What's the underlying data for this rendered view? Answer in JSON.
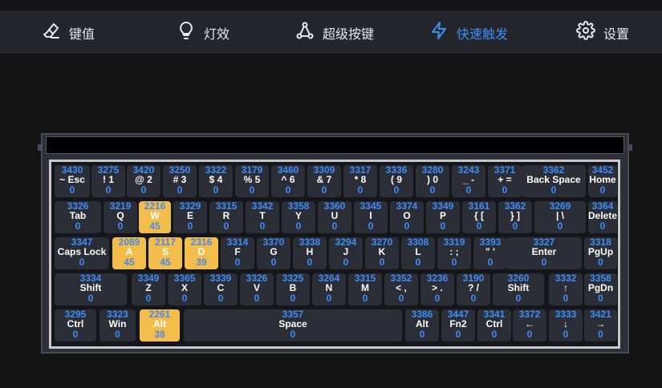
{
  "nav": [
    {
      "label": "键值",
      "icon": "eraser-icon",
      "active": false
    },
    {
      "label": "灯效",
      "icon": "lightbulb-icon",
      "active": false
    },
    {
      "label": "超级按键",
      "icon": "share-nodes-icon",
      "active": false
    },
    {
      "label": "快速触发",
      "icon": "lightning-icon",
      "active": true
    },
    {
      "label": "设置",
      "icon": "gear-icon",
      "active": false
    }
  ],
  "colors": {
    "accent": "#3f8ef7",
    "highlight": "#f2bd4a",
    "key_bg": "#2b2d37"
  },
  "rows": [
    [
      {
        "label": "~ Esc",
        "num": "3430",
        "val": "0"
      },
      {
        "label": "! 1",
        "num": "3275",
        "val": "0"
      },
      {
        "label": "@ 2",
        "num": "3420",
        "val": "0"
      },
      {
        "label": "# 3",
        "num": "3250",
        "val": "0"
      },
      {
        "label": "$ 4",
        "num": "3322",
        "val": "0"
      },
      {
        "label": "% 5",
        "num": "3179",
        "val": "0"
      },
      {
        "label": "^ 6",
        "num": "3460",
        "val": "0"
      },
      {
        "label": "& 7",
        "num": "3309",
        "val": "0"
      },
      {
        "label": "* 8",
        "num": "3317",
        "val": "0"
      },
      {
        "label": "( 9",
        "num": "3336",
        "val": "0"
      },
      {
        "label": ") 0",
        "num": "3280",
        "val": "0"
      },
      {
        "label": "_ -",
        "num": "3243",
        "val": "0"
      },
      {
        "label": "+ =",
        "num": "3371",
        "val": "0"
      },
      {
        "label": "Back Space",
        "num": "3362",
        "val": "0"
      },
      {
        "label": "Home",
        "num": "3452",
        "val": "0"
      }
    ],
    [
      {
        "label": "Tab",
        "num": "3326",
        "val": "0"
      },
      {
        "label": "Q",
        "num": "3219",
        "val": "0"
      },
      {
        "label": "W",
        "num": "2216",
        "val": "45",
        "hl": true
      },
      {
        "label": "E",
        "num": "3329",
        "val": "0"
      },
      {
        "label": "R",
        "num": "3315",
        "val": "0"
      },
      {
        "label": "T",
        "num": "3342",
        "val": "0"
      },
      {
        "label": "Y",
        "num": "3358",
        "val": "0"
      },
      {
        "label": "U",
        "num": "3360",
        "val": "0"
      },
      {
        "label": "I",
        "num": "3345",
        "val": "0"
      },
      {
        "label": "O",
        "num": "3374",
        "val": "0"
      },
      {
        "label": "P",
        "num": "3349",
        "val": "0"
      },
      {
        "label": "{ [",
        "num": "3161",
        "val": "0"
      },
      {
        "label": "} ]",
        "num": "3362",
        "val": "0"
      },
      {
        "label": "| \\",
        "num": "3269",
        "val": "0"
      },
      {
        "label": "Delete",
        "num": "3364",
        "val": "0"
      }
    ],
    [
      {
        "label": "Caps Lock",
        "num": "3347",
        "val": "0"
      },
      {
        "label": "A",
        "num": "2089",
        "val": "45",
        "hl": true
      },
      {
        "label": "S",
        "num": "2117",
        "val": "45",
        "hl": true
      },
      {
        "label": "D",
        "num": "2316",
        "val": "39",
        "hl": true
      },
      {
        "label": "F",
        "num": "3314",
        "val": "0"
      },
      {
        "label": "G",
        "num": "3370",
        "val": "0"
      },
      {
        "label": "H",
        "num": "3338",
        "val": "0"
      },
      {
        "label": "J",
        "num": "3294",
        "val": "0"
      },
      {
        "label": "K",
        "num": "3270",
        "val": "0"
      },
      {
        "label": "L",
        "num": "3308",
        "val": "0"
      },
      {
        "label": ": ;",
        "num": "3319",
        "val": "0"
      },
      {
        "label": "\" '",
        "num": "3393",
        "val": "0"
      },
      {
        "label": "Enter",
        "num": "3327",
        "val": "0"
      },
      {
        "label": "PgUp",
        "num": "3318",
        "val": "0"
      }
    ],
    [
      {
        "label": "Shift",
        "num": "3334",
        "val": "0"
      },
      {
        "label": "Z",
        "num": "3349",
        "val": "0"
      },
      {
        "label": "X",
        "num": "3365",
        "val": "0"
      },
      {
        "label": "C",
        "num": "3339",
        "val": "0"
      },
      {
        "label": "V",
        "num": "3326",
        "val": "0"
      },
      {
        "label": "B",
        "num": "3325",
        "val": "0"
      },
      {
        "label": "N",
        "num": "3264",
        "val": "0"
      },
      {
        "label": "M",
        "num": "3315",
        "val": "0"
      },
      {
        "label": "< ,",
        "num": "3352",
        "val": "0"
      },
      {
        "label": "> .",
        "num": "3236",
        "val": "0"
      },
      {
        "label": "? /",
        "num": "3190",
        "val": "0"
      },
      {
        "label": "Shift",
        "num": "3260",
        "val": "0"
      },
      {
        "label": "↑",
        "num": "3332",
        "val": "0"
      },
      {
        "label": "PgDn",
        "num": "3358",
        "val": "0"
      }
    ],
    [
      {
        "label": "Ctrl",
        "num": "3295",
        "val": "0"
      },
      {
        "label": "Win",
        "num": "3323",
        "val": "0"
      },
      {
        "label": "Alt",
        "num": "2261",
        "val": "38",
        "hl": true
      },
      {
        "label": "Space",
        "num": "3357",
        "val": "0"
      },
      {
        "label": "Alt",
        "num": "3386",
        "val": "0"
      },
      {
        "label": "Fn2",
        "num": "3447",
        "val": "0"
      },
      {
        "label": "Ctrl",
        "num": "3341",
        "val": "0"
      },
      {
        "label": "←",
        "num": "3372",
        "val": "0"
      },
      {
        "label": "↓",
        "num": "3333",
        "val": "0"
      },
      {
        "label": "→",
        "num": "3421",
        "val": "0"
      }
    ]
  ]
}
